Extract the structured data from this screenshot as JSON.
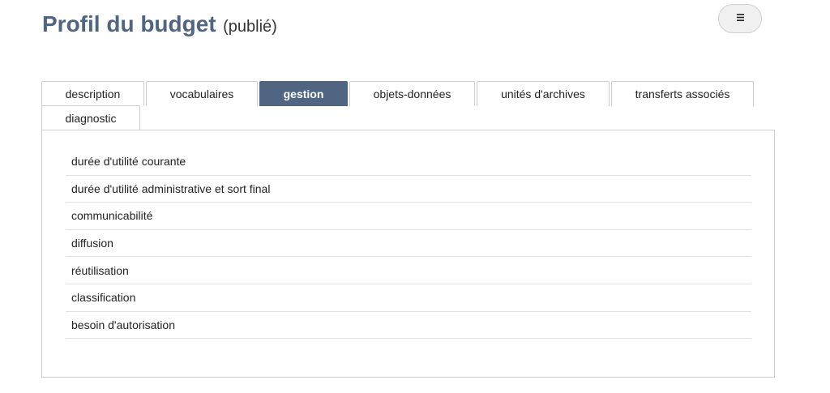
{
  "header": {
    "title": "Profil du budget",
    "status": "(publié)"
  },
  "menu": {
    "icon": "hamburger-menu-icon"
  },
  "tabs": [
    {
      "label": "description",
      "active": false
    },
    {
      "label": "vocabulaires",
      "active": false
    },
    {
      "label": "gestion",
      "active": true
    },
    {
      "label": "objets-données",
      "active": false
    },
    {
      "label": "unités d'archives",
      "active": false
    },
    {
      "label": "transferts associés",
      "active": false
    },
    {
      "label": "diagnostic",
      "active": false
    }
  ],
  "items": [
    "durée d'utilité courante",
    "durée d'utilité administrative et sort final",
    "communicabilité",
    "diffusion",
    "réutilisation",
    "classification",
    "besoin d'autorisation"
  ],
  "colors": {
    "accent": "#4f6582",
    "border": "#cccccc"
  }
}
